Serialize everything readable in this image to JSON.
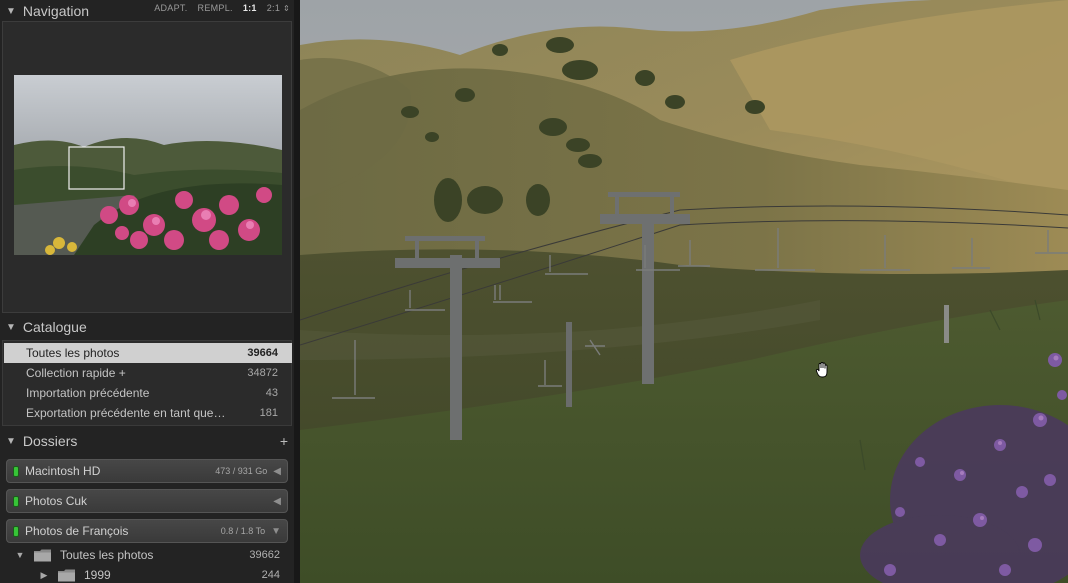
{
  "navigation": {
    "title": "Navigation",
    "zoom_options": [
      "ADAPT.",
      "REMPL.",
      "1:1",
      "2:1"
    ],
    "active_zoom": "1:1"
  },
  "catalogue": {
    "title": "Catalogue",
    "items": [
      {
        "label": "Toutes les photos",
        "count": "39664",
        "selected": true
      },
      {
        "label": "Collection rapide +",
        "count": "34872"
      },
      {
        "label": "Importation précédente",
        "count": "43"
      },
      {
        "label": "Exportation précédente en tant que…",
        "count": "181"
      }
    ]
  },
  "dossiers": {
    "title": "Dossiers",
    "add_label": "+",
    "volumes": [
      {
        "name": "Macintosh HD",
        "size": "473 / 931 Go",
        "online": true
      },
      {
        "name": "Photos Cuk",
        "size": "",
        "online": true
      },
      {
        "name": "Photos de François",
        "size": "0.8 / 1.8 To",
        "online": true
      }
    ],
    "folders": [
      {
        "name": "Toutes les photos",
        "count": "39662",
        "expanded": true
      },
      {
        "name": "1999",
        "count": "244",
        "expanded": false
      }
    ]
  },
  "colors": {
    "panel_bg": "#232323",
    "selected_row": "#d0d0d0",
    "online_led": "#37c437",
    "accent_text": "#cfcfcf"
  },
  "icons": {
    "collapse": "triangle-down-icon",
    "expand": "triangle-right-icon",
    "folder": "folder-icon",
    "cursor": "hand-grab-icon"
  }
}
